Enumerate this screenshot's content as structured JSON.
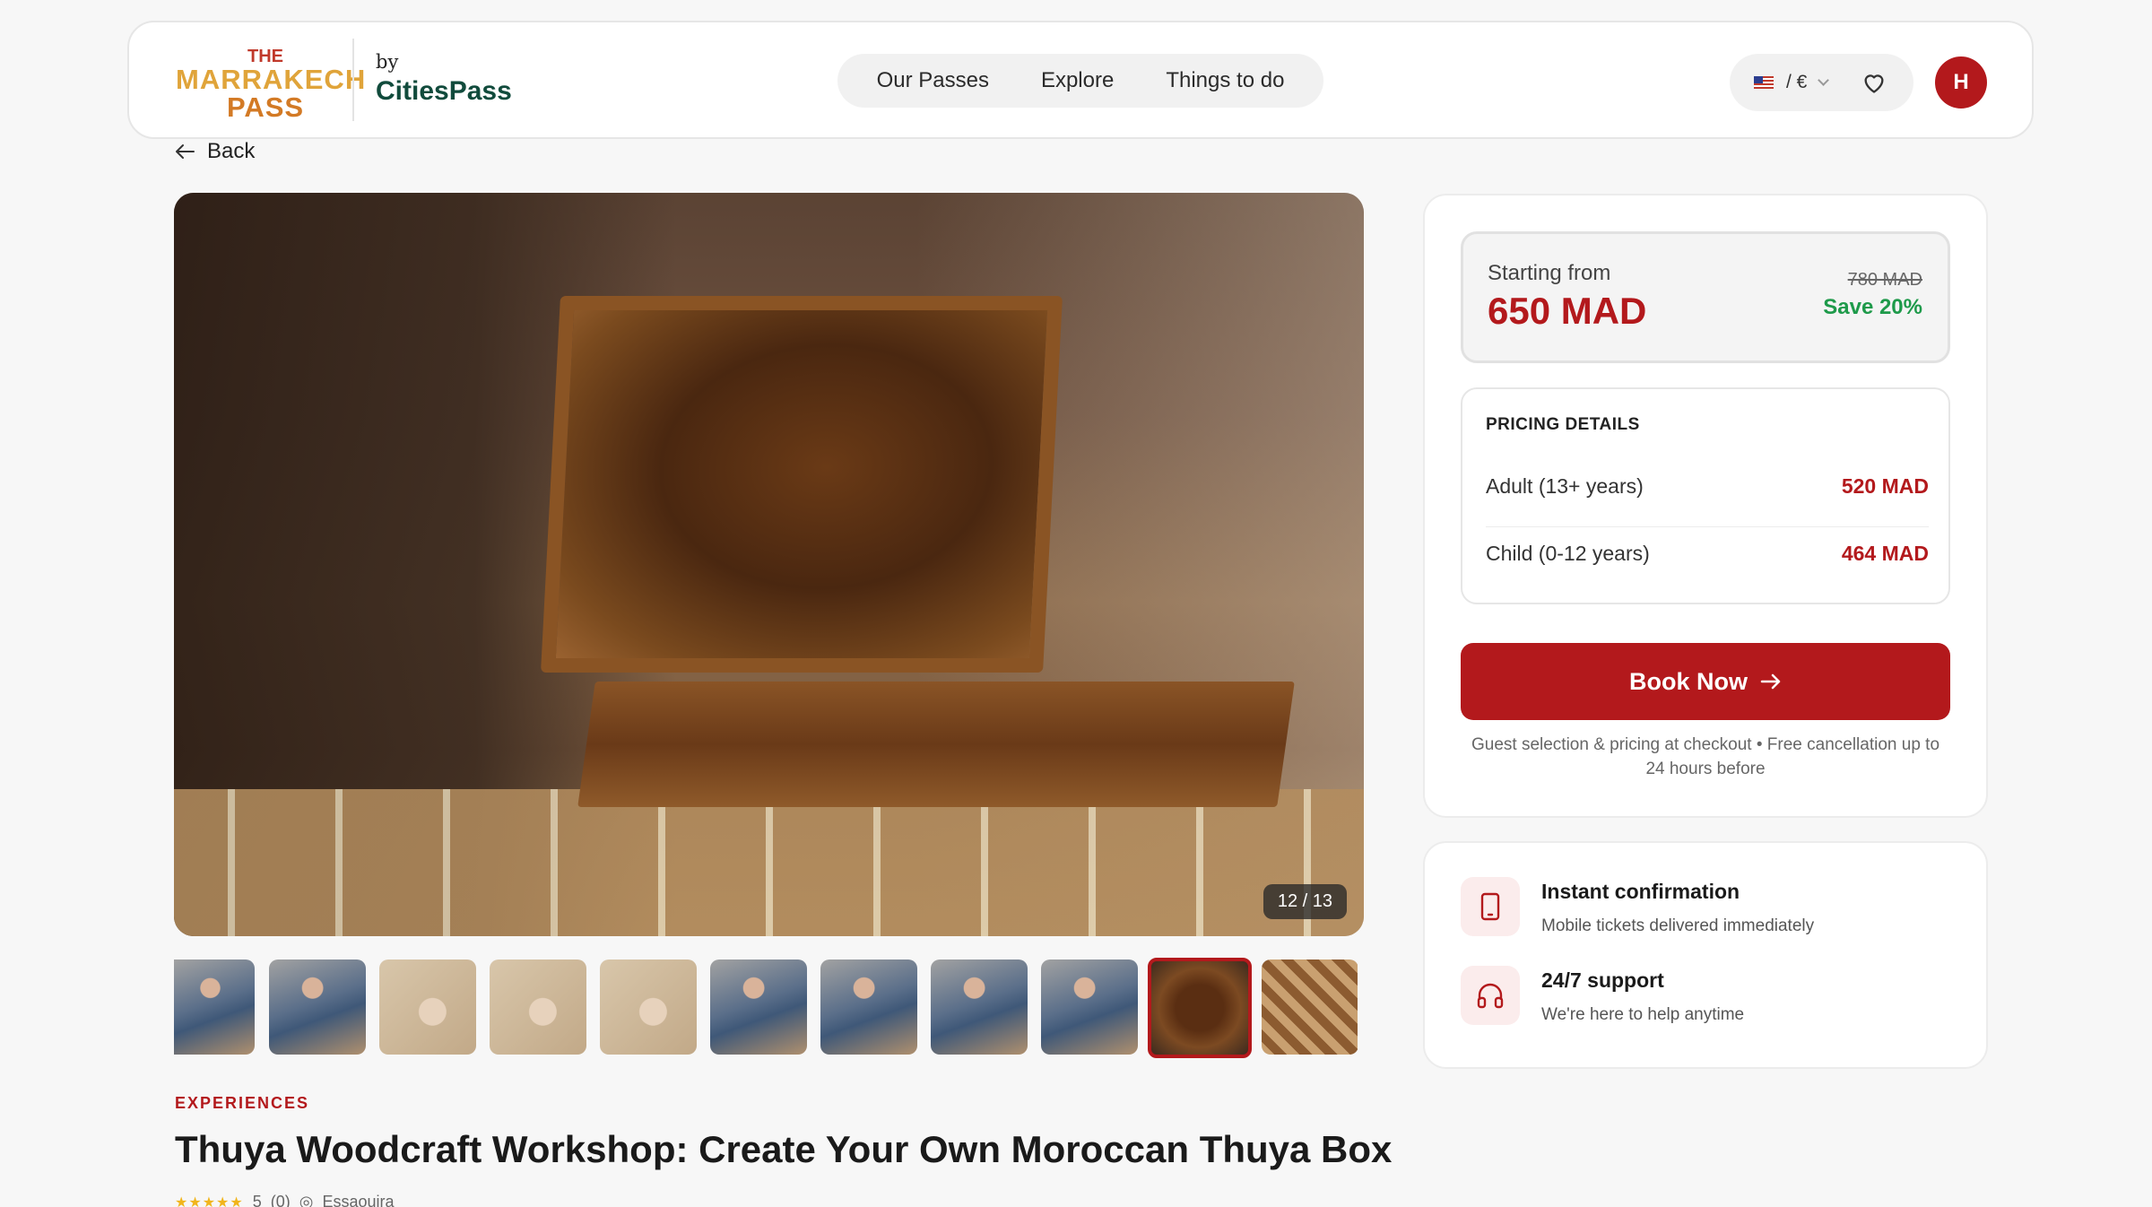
{
  "header": {
    "logo": {
      "line1": "THE",
      "line2": "MARRAKECH",
      "line3": "PASS"
    },
    "by": "by",
    "brand": "CitiesPass",
    "nav": [
      "Our Passes",
      "Explore",
      "Things to do"
    ],
    "preference": "/ €",
    "avatar_initial": "H"
  },
  "back_label": "Back",
  "gallery": {
    "counter": "12 / 13",
    "thumb_count": 11,
    "active_index": 9
  },
  "listing": {
    "category": "EXPERIENCES",
    "title": "Thuya Woodcraft Workshop: Create Your Own Moroccan Thuya Box",
    "rating_stars": "★★★★★",
    "rating_value": "5",
    "rating_count": "(0)",
    "location": "Essaouira"
  },
  "booking": {
    "starting_label": "Starting from",
    "price": "650 MAD",
    "old_price": "780 MAD",
    "save": "Save 20%",
    "pricing_heading": "PRICING DETAILS",
    "rows": [
      {
        "label": "Adult (13+ years)",
        "value": "520 MAD"
      },
      {
        "label": "Child (0-12 years)",
        "value": "464 MAD"
      }
    ],
    "button": "Book Now",
    "note": "Guest selection & pricing at checkout • Free cancellation up to 24 hours before"
  },
  "info": [
    {
      "icon": "phone-icon",
      "title": "Instant confirmation",
      "subtitle": "Mobile tickets delivered immediately"
    },
    {
      "icon": "headphones-icon",
      "title": "24/7 support",
      "subtitle": "We're here to help anytime"
    }
  ],
  "colors": {
    "accent": "#b3191c",
    "save": "#1e9a4a",
    "background": "#f7f7f7"
  }
}
